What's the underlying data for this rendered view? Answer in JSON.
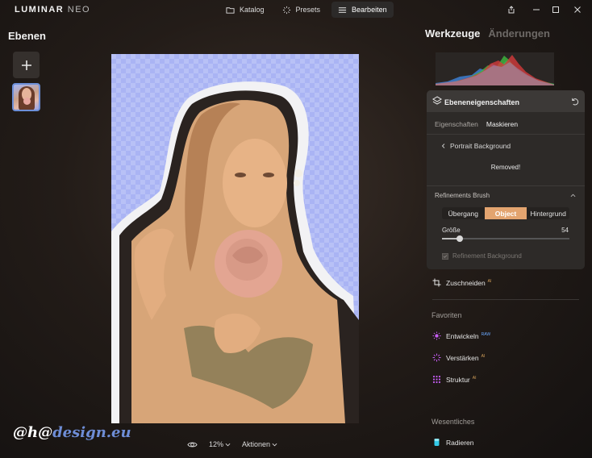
{
  "app": {
    "logo_main": "LUMINAR",
    "logo_sub": "NEO"
  },
  "topnav": {
    "items": [
      {
        "label": "Katalog",
        "icon": "folder-icon"
      },
      {
        "label": "Presets",
        "icon": "sparkle-icon"
      },
      {
        "label": "Bearbeiten",
        "icon": "sliders-icon",
        "active": true
      }
    ]
  },
  "left": {
    "title": "Ebenen"
  },
  "bottombar": {
    "zoom": "12%",
    "actions": "Aktionen"
  },
  "watermark": {
    "prefix": "@h@",
    "suffix": "design.eu"
  },
  "right": {
    "tab_active": "Werkzeuge",
    "tab_inactive": "Änderungen",
    "panel": {
      "title": "Ebeneneigenschaften",
      "subtab_1": "Eigenschaften",
      "subtab_2": "Maskieren",
      "crumb": "Portrait Background",
      "status": "Removed!",
      "refinements_label": "Refinements Brush",
      "segments": [
        "Übergang",
        "Object",
        "Hintergrund"
      ],
      "segment_selected": 1,
      "size_label": "Größe",
      "size_value": "54",
      "size_fraction": 0.14,
      "refine_bg_label": "Refinement Background"
    },
    "tools": {
      "crop": "Zuschneiden",
      "crop_badge": "AI",
      "favorites_title": "Favoriten",
      "develop": "Entwickeln",
      "develop_badge": "RAW",
      "enhance": "Verstärken",
      "enhance_badge": "AI",
      "structure": "Struktur",
      "structure_badge": "AI",
      "essentials_title": "Wesentliches",
      "erase": "Radieren"
    }
  },
  "colors": {
    "accent": "#e3a46f",
    "canvas_bg": "#aab4f4",
    "selection_border": "#6c8fd8",
    "ai_badge": "#d4a05a",
    "tool_purple": "#c35cf0",
    "erase_cyan": "#33c9e8"
  }
}
